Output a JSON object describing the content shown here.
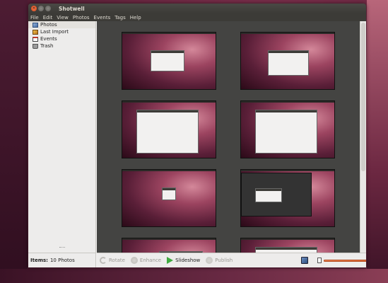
{
  "window": {
    "title": "Shotwell"
  },
  "menu": [
    "File",
    "Edit",
    "View",
    "Photos",
    "Events",
    "Tags",
    "Help"
  ],
  "sidebar": {
    "items": [
      {
        "label": "Photos",
        "icon": "photos-icon",
        "selected": true
      },
      {
        "label": "Last Import",
        "icon": "last-import-icon",
        "selected": false
      },
      {
        "label": "Events",
        "icon": "events-icon",
        "selected": false
      },
      {
        "label": "Trash",
        "icon": "trash-icon",
        "selected": false
      }
    ]
  },
  "status": {
    "items_label": "Items:",
    "items_value": "10 Photos"
  },
  "toolbar": {
    "rotate_label": "Rotate",
    "enhance_label": "Enhance",
    "slideshow_label": "Slideshow",
    "publish_label": "Publish"
  },
  "zoom": {
    "level": 0.65
  },
  "colors": {
    "accent": "#e05d26",
    "window_chrome": "#3c3b37",
    "content_bg": "#444442"
  },
  "photos_count": 10
}
